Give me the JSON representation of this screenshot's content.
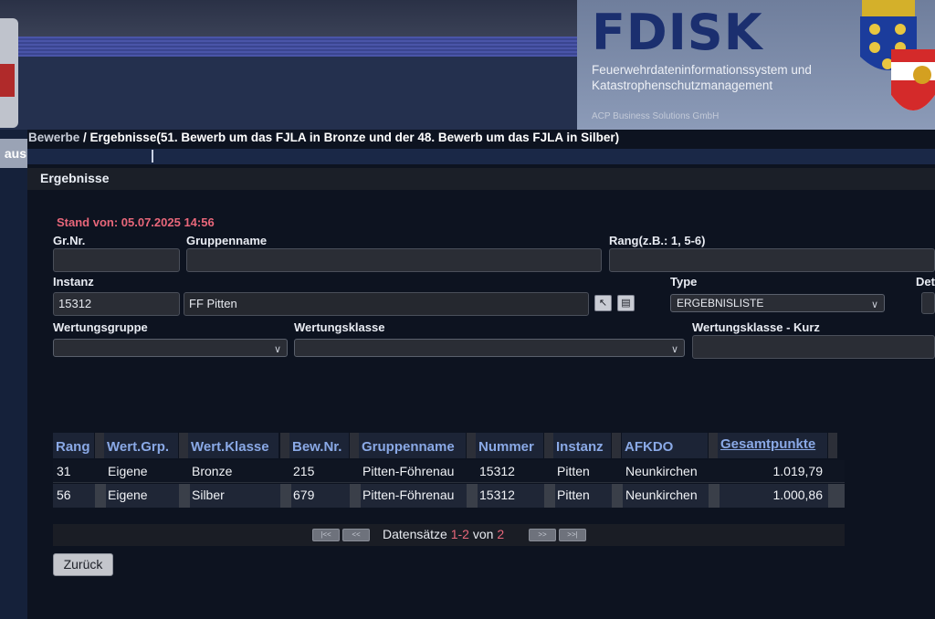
{
  "header": {
    "brand": "FDISK",
    "tagline_line1": "Feuerwehrdateninformationssystem und",
    "tagline_line2": "Katastrophenschutzmanagement",
    "company": "ACP Business Solutions GmbH",
    "sidebar_tab": "aus"
  },
  "breadcrumb": {
    "link": "Bewerbe",
    "separator": " / ",
    "current": "Ergebnisse(51. Bewerb um das FJLA in Bronze und der 48. Bewerb um das FJLA in Silber)"
  },
  "panel": {
    "title": "Ergebnisse",
    "stand": "Stand von: 05.07.2025 14:56"
  },
  "form": {
    "grnr_label": "Gr.Nr.",
    "grnr_value": "",
    "gruppenname_label": "Gruppenname",
    "gruppenname_value": "",
    "rang_label": "Rang(z.B.: 1, 5-6)",
    "rang_value": "",
    "instanz_label": "Instanz",
    "instanz_value": "15312",
    "instanz_name": "FF Pitten",
    "type_label": "Type",
    "type_value": "ERGEBNISLISTE",
    "det_label": "Det",
    "wertungsgruppe_label": "Wertungsgruppe",
    "wertungsgruppe_value": "",
    "wertungsklasse_label": "Wertungsklasse",
    "wertungsklasse_value": "",
    "wertungsklasse_kurz_label": "Wertungsklasse - Kurz",
    "wertungsklasse_kurz_value": ""
  },
  "table": {
    "columns": [
      "Rang",
      "Wert.Grp.",
      "Wert.Klasse",
      "Bew.Nr.",
      "Gruppenname",
      "Nummer",
      "Instanz",
      "AFKDO",
      "Gesamtpunkte"
    ],
    "rows": [
      [
        "31",
        "Eigene",
        "Bronze",
        "215",
        "Pitten-Föhrenau",
        "15312",
        "Pitten",
        "Neunkirchen",
        "1.019,79"
      ],
      [
        "56",
        "Eigene",
        "Silber",
        "679",
        "Pitten-Föhrenau",
        "15312",
        "Pitten",
        "Neunkirchen",
        "1.000,86"
      ]
    ]
  },
  "pager": {
    "label": "Datensätze",
    "range": "1-2",
    "of": "von",
    "total": "2",
    "first": "|<<",
    "prev": "<<",
    "next": ">>",
    "last": ">>|"
  },
  "back_label": "Zurück",
  "colors": {
    "accent_red": "#e8677a",
    "header_blue": "#8aa9e6",
    "brand_blue": "#1b2f6f"
  }
}
